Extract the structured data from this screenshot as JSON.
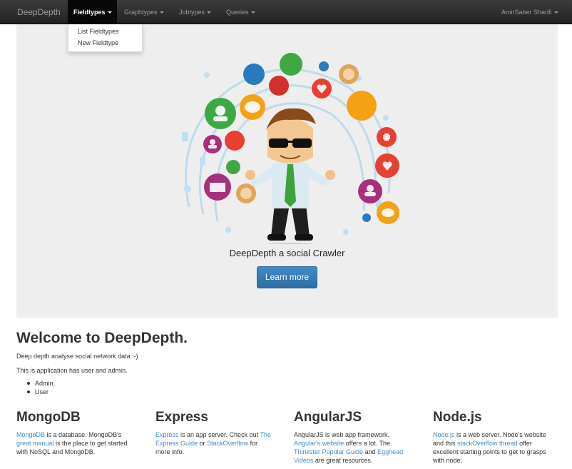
{
  "navbar": {
    "brand": "DeepDepth",
    "items": [
      {
        "label": "Fieldtypes",
        "active": true
      },
      {
        "label": "Graphtypes",
        "active": false
      },
      {
        "label": "Jobtypes",
        "active": false
      },
      {
        "label": "Queries",
        "active": false
      }
    ],
    "user": "AmirSaber Sharifi"
  },
  "dropdown": {
    "items": [
      "List Fieldtypes",
      "New Fieldtype"
    ]
  },
  "hero": {
    "tagline": "DeepDepth a social Crawler",
    "button_label": "Learn more"
  },
  "welcome": {
    "title": "Welcome to DeepDepth.",
    "p1": "Deep depth analyse social network data :-)",
    "p2": "This is application has user and admin.",
    "roles": [
      "Admin.",
      "User"
    ]
  },
  "columns": {
    "mongodb": {
      "title": "MongoDB",
      "link1": "MongoDB",
      "t1": " is a database. MongoDB's ",
      "link2": "great manual",
      "t2": " is the place to get started with NoSQL and MongoDB."
    },
    "express": {
      "title": "Express",
      "link1": "Express",
      "t1": " is an app server. Check out ",
      "link2": "The Express Guide",
      "t2": " or ",
      "link3": "StackOverflow",
      "t3": " for more info."
    },
    "angular": {
      "title": "AngularJS",
      "t0": "AngularJS is web app framework. ",
      "link1": "Angular's website",
      "t1": " offers a lot. The ",
      "link2": "Thinkster Popular Guide",
      "t2": " and ",
      "link3": "Egghead Videos",
      "t3": " are great resources."
    },
    "node": {
      "title": "Node.js",
      "link1": "Node.js",
      "t1": " is a web server. Node's website and this ",
      "link2": "stackOverflow thread",
      "t2": " offer excellent starting points to get to grasps with node."
    }
  },
  "colors": {
    "link": "#428bca",
    "navbar": "#222222",
    "jumbotron": "#eeeeee",
    "button": "#428bca"
  }
}
